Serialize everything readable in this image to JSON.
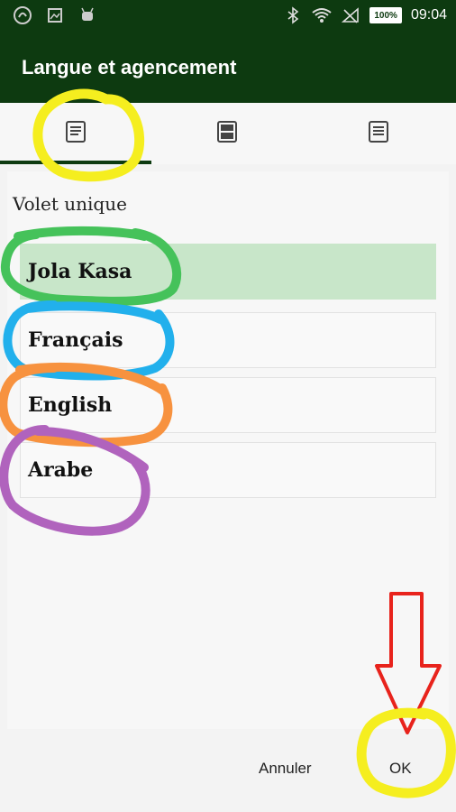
{
  "status_bar": {
    "time": "09:04",
    "battery": "100%"
  },
  "app_bar": {
    "title": "Langue et agencement"
  },
  "tabs": [
    {
      "icon": "single-pane-icon",
      "selected": true
    },
    {
      "icon": "two-pane-icon",
      "selected": false
    },
    {
      "icon": "three-pane-icon",
      "selected": false
    }
  ],
  "section": {
    "label": "Volet unique"
  },
  "languages": [
    {
      "label": "Jola Kasa",
      "selected": true
    },
    {
      "label": "Français",
      "selected": false
    },
    {
      "label": "English",
      "selected": false
    },
    {
      "label": "Arabe",
      "selected": false
    }
  ],
  "buttons": {
    "cancel": "Annuler",
    "ok": "OK"
  },
  "colors": {
    "app_bar": "#0d3a10",
    "selected_item": "#c8e6c9",
    "annotation_yellow": "#f5ee1f",
    "annotation_green": "#45c25a",
    "annotation_blue": "#22b0ec",
    "annotation_orange": "#f7923f",
    "annotation_purple": "#b063bd",
    "annotation_red": "#e8231c"
  }
}
